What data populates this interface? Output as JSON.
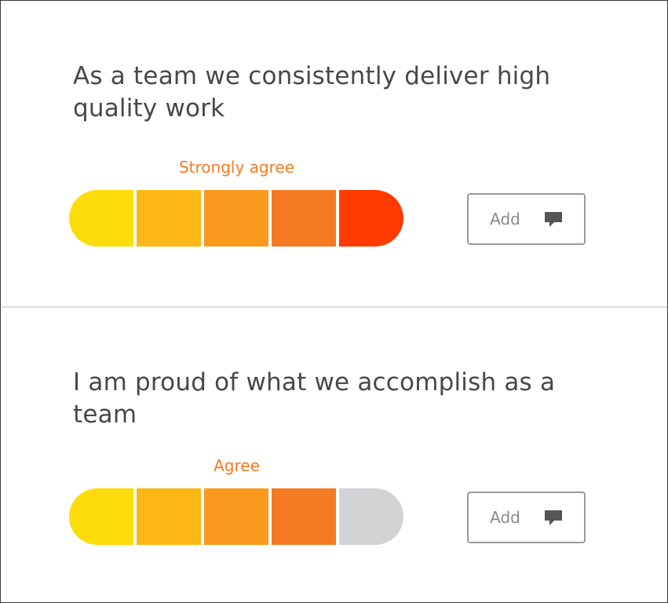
{
  "questions": [
    {
      "text": "As a team we consistently deliver high quality work",
      "answer": "Strongly agree",
      "selected_level": 5,
      "segments": [
        "#fddc0c",
        "#fcb816",
        "#f99a1f",
        "#f47b22",
        "#ff3b00"
      ],
      "add_label": "Add",
      "add_icon": "comment-icon"
    },
    {
      "text": "I am proud of what we accomplish as a team",
      "answer": "Agree",
      "selected_level": 4,
      "segments": [
        "#fddc0c",
        "#fcb816",
        "#f99a1f",
        "#f47b22",
        "#d2d3d5"
      ],
      "add_label": "Add",
      "add_icon": "comment-icon"
    }
  ],
  "colors": {
    "answer_text": "#f47b22",
    "question_text": "#484848",
    "unselected": "#d2d3d5",
    "button_border": "#9b9b9b",
    "icon": "#555555"
  }
}
